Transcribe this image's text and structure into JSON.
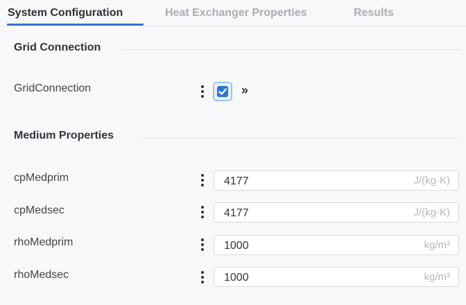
{
  "tabs": [
    {
      "label": "System Configuration",
      "active": true
    },
    {
      "label": "Heat Exchanger Properties",
      "active": false
    },
    {
      "label": "Results",
      "active": false
    }
  ],
  "sections": {
    "grid": {
      "title": "Grid Connection",
      "params": [
        {
          "label": "GridConnection",
          "checked": true,
          "expand_glyph": "»"
        }
      ]
    },
    "medium": {
      "title": "Medium Properties",
      "params": [
        {
          "label": "cpMedprim",
          "value": "4177",
          "unit": "J/(kg·K)"
        },
        {
          "label": "cpMedsec",
          "value": "4177",
          "unit": "J/(kg·K)"
        },
        {
          "label": "rhoMedprim",
          "value": "1000",
          "unit": "kg/m³"
        },
        {
          "label": "rhoMedsec",
          "value": "1000",
          "unit": "kg/m³"
        }
      ]
    }
  },
  "colors": {
    "accent": "#3b6fd1",
    "checkbox": "#2a73d8",
    "background": "#f7f8f9"
  },
  "icons": {
    "param_menu": "kebab-menu-icon",
    "checkbox_mark": "checkmark-icon",
    "expand": "double-chevron-right-icon"
  }
}
